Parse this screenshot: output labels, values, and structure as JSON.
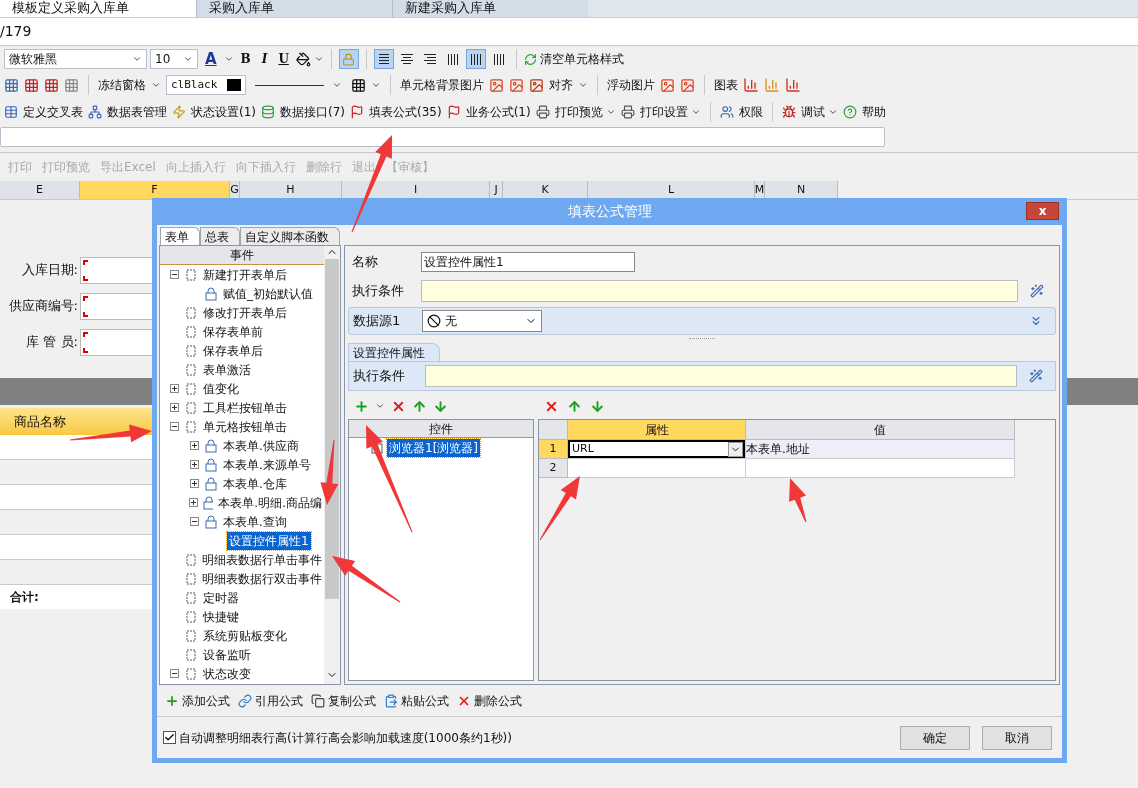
{
  "browser_tabs": [
    {
      "label": "模板定义采购入库单",
      "selected": true
    },
    {
      "label": "采购入库单",
      "selected": false
    },
    {
      "label": "新建采购入库单",
      "selected": false
    }
  ],
  "address": "/179",
  "format_toolbar": {
    "font": "微软雅黑",
    "size": "10",
    "font_color": "A",
    "bold": "B",
    "italic": "I",
    "underline": "U",
    "lock_on": true,
    "align": [
      {
        "selected": true
      },
      {
        "selected": false
      },
      {
        "selected": false
      }
    ],
    "distribute": [
      {
        "selected": false
      },
      {
        "selected": true
      },
      {
        "selected": false
      }
    ],
    "clear_style": "清空单元格样式"
  },
  "cell_toolbar": {
    "freeze": "冻结窗格",
    "color_text": "clBlack",
    "bg_image": "单元格背景图片",
    "align": "对齐",
    "float_image": "浮动图片",
    "chart": "图表"
  },
  "main_toolbar": [
    {
      "label": "定义交叉表",
      "dropdown": false
    },
    {
      "label": "数据表管理",
      "dropdown": false
    },
    {
      "label": "状态设置(1)",
      "dropdown": false
    },
    {
      "label": "数据接口(7)",
      "dropdown": false
    },
    {
      "label": "填表公式(35)",
      "dropdown": false
    },
    {
      "label": "业务公式(1)",
      "dropdown": false
    },
    {
      "label": "打印预览",
      "dropdown": true
    },
    {
      "label": "打印设置",
      "dropdown": true
    },
    {
      "label": "权限",
      "dropdown": false
    },
    {
      "label": "调试",
      "dropdown": true
    },
    {
      "label": "帮助",
      "dropdown": false
    }
  ],
  "sheet_toolbar": [
    {
      "label": "打印",
      "disabled": true
    },
    {
      "label": "打印预览",
      "disabled": true
    },
    {
      "label": "导出Excel",
      "disabled": true
    },
    {
      "label": "向上插入行",
      "disabled": true
    },
    {
      "label": "向下插入行",
      "disabled": true
    },
    {
      "label": "删除行",
      "disabled": true
    },
    {
      "label": "退出",
      "disabled": true
    },
    {
      "label": "【审核】",
      "disabled": true
    }
  ],
  "columns": [
    {
      "label": "E",
      "selected": false
    },
    {
      "label": "F",
      "selected": true
    },
    {
      "label": "G",
      "selected": false
    },
    {
      "label": "H",
      "selected": false
    },
    {
      "label": "I",
      "selected": false
    },
    {
      "label": "J",
      "selected": false
    },
    {
      "label": "K",
      "selected": false
    },
    {
      "label": "L",
      "selected": false
    },
    {
      "label": "M",
      "selected": false
    },
    {
      "label": "N",
      "selected": false
    }
  ],
  "form_fields": [
    {
      "label": "入库日期:"
    },
    {
      "label": "供应商编号:"
    },
    {
      "label": "库 管 员:"
    }
  ],
  "detail_header": "商品名称",
  "total_label": "合计:",
  "dialog": {
    "title": "填表公式管理",
    "close": "x",
    "tabs": [
      {
        "label": "表单",
        "selected": true
      },
      {
        "label": "总表",
        "selected": false
      },
      {
        "label": "自定义脚本函数",
        "selected": false
      }
    ],
    "tree_header": "事件",
    "tree": [
      {
        "label": "新建打开表单后",
        "expanded": true,
        "selected": false,
        "children": [
          {
            "label": "赋值_初始默认值",
            "selected": false
          }
        ]
      },
      {
        "label": "修改打开表单后",
        "selected": false
      },
      {
        "label": "保存表单前",
        "selected": false
      },
      {
        "label": "保存表单后",
        "selected": false
      },
      {
        "label": "表单激活",
        "selected": false
      },
      {
        "label": "值变化",
        "expanded": false,
        "selected": false
      },
      {
        "label": "工具栏按钮单击",
        "expanded": false,
        "selected": false
      },
      {
        "label": "单元格按钮单击",
        "expanded": true,
        "selected": false,
        "children": [
          {
            "label": "本表单.供应商",
            "expanded": false,
            "selected": false
          },
          {
            "label": "本表单.来源单号",
            "expanded": false,
            "selected": false
          },
          {
            "label": "本表单.仓库",
            "expanded": false,
            "selected": false
          },
          {
            "label": "本表单.明细.商品编",
            "expanded": false,
            "selected": false
          },
          {
            "label": "本表单.查询",
            "expanded": true,
            "selected": false,
            "children": [
              {
                "label": "设置控件属性1",
                "selected": true
              }
            ]
          }
        ]
      },
      {
        "label": "明细表数据行单击事件",
        "selected": false
      },
      {
        "label": "明细表数据行双击事件",
        "selected": false
      },
      {
        "label": "定时器",
        "selected": false
      },
      {
        "label": "快捷键",
        "selected": false
      },
      {
        "label": "系统剪贴板变化",
        "selected": false
      },
      {
        "label": "设备监听",
        "selected": false
      },
      {
        "label": "状态改变",
        "expanded": true,
        "selected": false
      }
    ],
    "name_label": "名称",
    "name_value": "设置控件属性1",
    "condition_label": "执行条件",
    "datasource_label": "数据源1",
    "datasource_value": "无",
    "action_tab": "设置控件属性",
    "action_condition_label": "执行条件",
    "control_header": "控件",
    "controls": [
      {
        "label": "浏览器1[浏览器]",
        "selected": true
      }
    ],
    "prop_columns": [
      {
        "label": "属性",
        "selected": true
      },
      {
        "label": "值",
        "selected": false
      }
    ],
    "prop_rows": [
      {
        "num": "1",
        "property": "URL",
        "value": "本表单.地址",
        "selected": true
      },
      {
        "num": "2",
        "selected": false
      }
    ],
    "actions": [
      "添加公式",
      "引用公式",
      "复制公式",
      "粘贴公式",
      "删除公式"
    ],
    "auto_height": {
      "label": "自动调整明细表行高(计算行高会影响加载速度(1000条约1秒))",
      "checked": true
    },
    "buttons": [
      "确定",
      "取消"
    ]
  }
}
